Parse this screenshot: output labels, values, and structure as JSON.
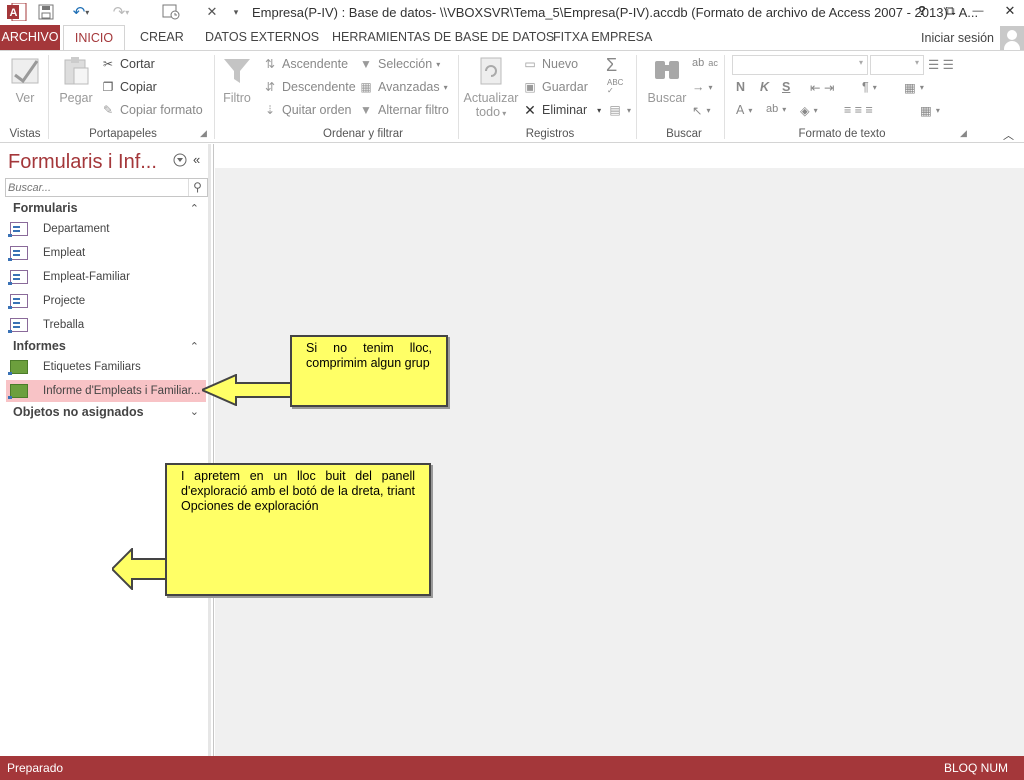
{
  "window": {
    "title": "Empresa(P-IV) : Base de datos- \\\\VBOXSVR\\Tema_5\\Empresa(P-IV).accdb (Formato de archivo de Access 2007 - 2013) - A...",
    "help": "?",
    "ribbon_display": "⧉",
    "minimize": "—",
    "restore": "❐",
    "close": "✕"
  },
  "tabs": [
    "ARCHIVO",
    "INICIO",
    "CREAR",
    "DATOS EXTERNOS",
    "HERRAMIENTAS DE BASE DE DATOS",
    "FITXA EMPRESA"
  ],
  "signin": "Iniciar sesión",
  "ribbon": {
    "vistas": {
      "ver": "Ver",
      "label": "Vistas"
    },
    "portapapeles": {
      "pegar": "Pegar",
      "cortar": "Cortar",
      "copiar": "Copiar",
      "copiar_formato": "Copiar formato",
      "label": "Portapapeles"
    },
    "ordenar": {
      "filtro": "Filtro",
      "ascendente": "Ascendente",
      "descendente": "Descendente",
      "quitar_orden": "Quitar orden",
      "seleccion": "Selección",
      "avanzadas": "Avanzadas",
      "alternar_filtro": "Alternar filtro",
      "label": "Ordenar y filtrar"
    },
    "registros": {
      "actualizar_1": "Actualizar",
      "actualizar_2": "todo",
      "nuevo": "Nuevo",
      "guardar": "Guardar",
      "eliminar": "Eliminar",
      "label": "Registros"
    },
    "buscar": {
      "buscar": "Buscar",
      "label": "Buscar"
    },
    "formato": {
      "n": "N",
      "k": "K",
      "s": "S",
      "a": "A",
      "label": "Formato de texto"
    }
  },
  "nav": {
    "title": "Formularis i Inf...",
    "search_placeholder": "Buscar...",
    "groups": [
      {
        "name": "Formularis",
        "items": [
          "Departament",
          "Empleat",
          "Empleat-Familiar",
          "Projecte",
          "Treballa"
        ]
      },
      {
        "name": "Informes",
        "items": [
          "Etiquetes Familiars",
          "Informe d'Empleats i Familiar..."
        ]
      },
      {
        "name": "Objetos no asignados",
        "items": []
      }
    ]
  },
  "callouts": {
    "one": "Si no tenim lloc, comprimim algun grup",
    "two": "I apretem en un lloc buit del panell d'exploració amb el botó de la dreta, triant Opciones de exploración"
  },
  "status": {
    "left": "Preparado",
    "right": "BLOQ NUM"
  },
  "colors": {
    "accent": "#a4373a",
    "selected_item": "#f8c3c6",
    "callout": "#ffff66"
  },
  "icons": [
    "access-logo-icon",
    "save-icon",
    "undo-icon",
    "redo-icon",
    "form-view-icon",
    "close-db-icon",
    "customize-icon",
    "view-icon",
    "paste-icon",
    "cut-icon",
    "copy-icon",
    "format-painter-icon",
    "filter-icon",
    "sort-asc-icon",
    "sort-desc-icon",
    "clear-sort-icon",
    "selection-icon",
    "advanced-icon",
    "toggle-filter-icon",
    "refresh-icon",
    "new-record-icon",
    "save-record-icon",
    "delete-icon",
    "totals-icon",
    "spelling-icon",
    "more-icon",
    "find-icon",
    "replace-icon",
    "goto-icon",
    "select-icon",
    "bold-icon",
    "italic-icon",
    "underline-icon",
    "font-color-icon",
    "highlight-icon",
    "fill-icon",
    "search-icon",
    "chevron-icon",
    "shutter-open-icon",
    "form-icon",
    "report-icon",
    "user-avatar-icon"
  ]
}
